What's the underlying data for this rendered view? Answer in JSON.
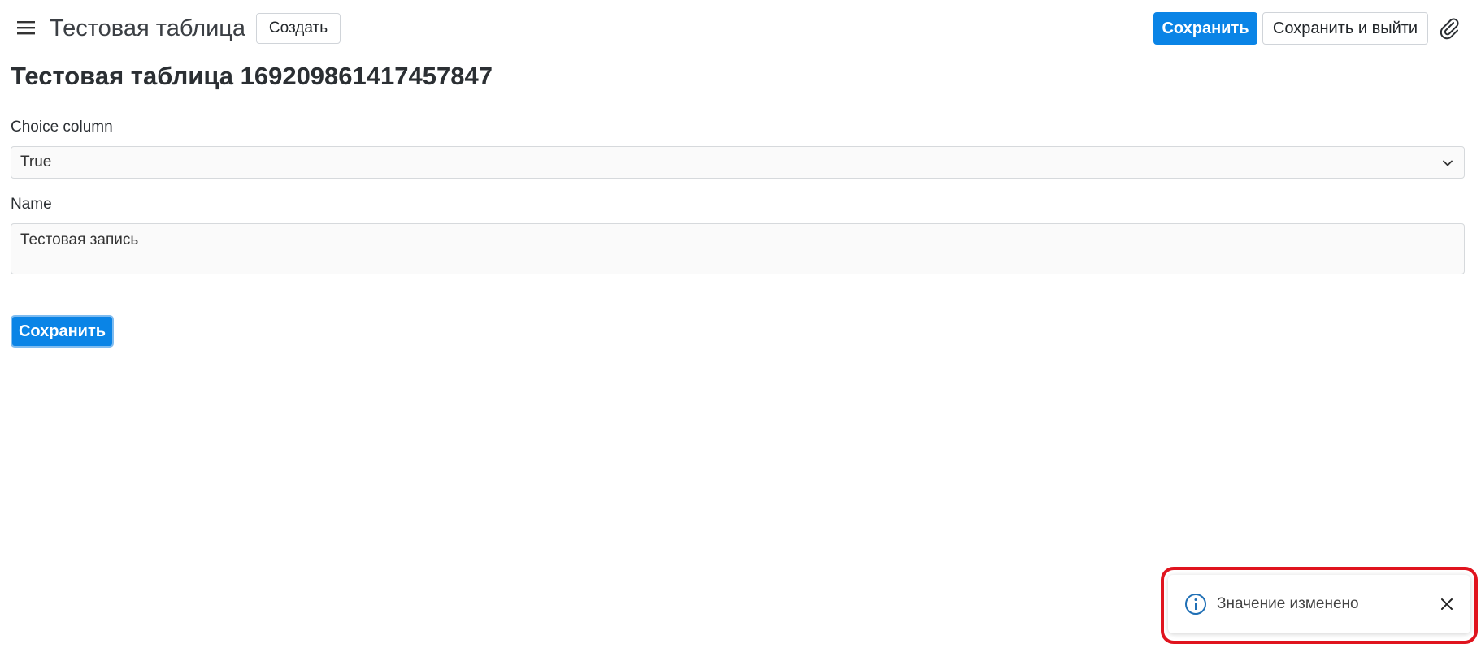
{
  "header": {
    "app_title": "Тестовая таблица",
    "create_label": "Создать",
    "save_label": "Сохранить",
    "save_exit_label": "Сохранить и выйти"
  },
  "page": {
    "title": "Тестовая таблица 169209861417457847"
  },
  "form": {
    "choice": {
      "label": "Choice column",
      "value": "True"
    },
    "name": {
      "label": "Name",
      "value": "Тестовая запись"
    },
    "save_label": "Сохранить"
  },
  "toast": {
    "message": "Значение изменено"
  },
  "colors": {
    "primary": "#0a84e6",
    "highlight": "#e0141e",
    "info": "#1f6fb5"
  },
  "icons": {
    "menu": "hamburger-icon",
    "attach": "paperclip-icon",
    "dropdown": "chevron-down-icon",
    "info": "info-icon",
    "close": "close-icon"
  }
}
